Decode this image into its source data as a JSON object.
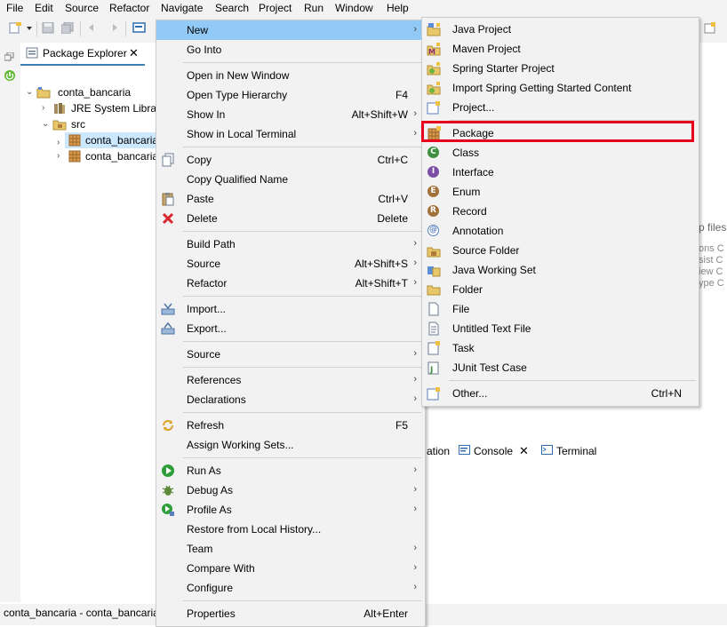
{
  "menubar": [
    "File",
    "Edit",
    "Source",
    "Refactor",
    "Navigate",
    "Search",
    "Project",
    "Run",
    "Window",
    "Help"
  ],
  "package_explorer": {
    "tab_label": "Package Explorer",
    "project": "conta_bancaria",
    "jre": "JRE System Library",
    "src": "src",
    "pkg1": "conta_bancaria",
    "pkg2": "conta_bancaria"
  },
  "background_right": {
    "lines": [
      "p files",
      "ons  C",
      "sist  C",
      "iew  C",
      "ype  C"
    ],
    "tab_partial": "ation",
    "console_tab": "Console",
    "terminal_tab": "Terminal"
  },
  "status_text": "conta_bancaria - conta_bancaria",
  "context_menu": {
    "new": "New",
    "go_into": "Go Into",
    "open_new_window": "Open in New Window",
    "open_type_hierarchy": "Open Type Hierarchy",
    "open_type_hierarchy_sc": "F4",
    "show_in": "Show In",
    "show_in_sc": "Alt+Shift+W",
    "show_local_terminal": "Show in Local Terminal",
    "copy": "Copy",
    "copy_sc": "Ctrl+C",
    "copy_qualified": "Copy Qualified Name",
    "paste": "Paste",
    "paste_sc": "Ctrl+V",
    "delete": "Delete",
    "delete_sc": "Delete",
    "build_path": "Build Path",
    "source": "Source",
    "source_sc": "Alt+Shift+S",
    "refactor": "Refactor",
    "refactor_sc": "Alt+Shift+T",
    "import": "Import...",
    "export": "Export...",
    "source2": "Source",
    "references": "References",
    "declarations": "Declarations",
    "refresh": "Refresh",
    "refresh_sc": "F5",
    "assign_working_sets": "Assign Working Sets...",
    "run_as": "Run As",
    "debug_as": "Debug As",
    "profile_as": "Profile As",
    "restore_history": "Restore from Local History...",
    "team": "Team",
    "compare_with": "Compare With",
    "configure": "Configure",
    "properties": "Properties",
    "properties_sc": "Alt+Enter"
  },
  "new_submenu": {
    "java_project": "Java Project",
    "maven_project": "Maven Project",
    "spring_starter": "Spring Starter Project",
    "import_spring": "Import Spring Getting Started Content",
    "project": "Project...",
    "package": "Package",
    "class": "Class",
    "interface": "Interface",
    "enum": "Enum",
    "record": "Record",
    "annotation": "Annotation",
    "source_folder": "Source Folder",
    "java_working_set": "Java Working Set",
    "folder": "Folder",
    "file": "File",
    "untitled_text": "Untitled Text File",
    "task": "Task",
    "junit": "JUnit Test Case",
    "other": "Other...",
    "other_sc": "Ctrl+N"
  },
  "colors": {
    "highlight": "#91c9f7",
    "annotation_box": "#e8001c",
    "class_icon": "#3e8f3e",
    "interface_icon": "#7a4ea6",
    "enum_icon": "#a0723a",
    "run_icon": "#2e9e3a"
  }
}
